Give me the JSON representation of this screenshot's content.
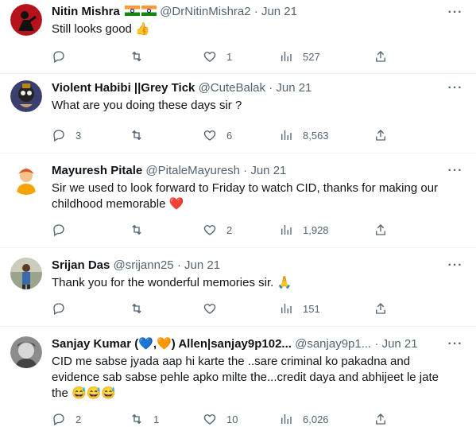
{
  "tweets": [
    {
      "name": "Nitin Mishra",
      "name_suffix_flags": 2,
      "handle": "@DrNitinMishra2",
      "sep": "·",
      "date": "Jun 21",
      "text": "Still looks good",
      "text_emoji": "👍",
      "replies": "",
      "retweets": "",
      "likes": "1",
      "views": "527",
      "avatar_color": "#c1121f"
    },
    {
      "name": "Violent Habibi ||Grey Tick",
      "handle": "@CuteBalak",
      "sep": "·",
      "date": "Jun 21",
      "text": "What are you doing these days  sir ?",
      "replies": "3",
      "retweets": "",
      "likes": "6",
      "views": "8,563",
      "avatar_color": "#2b2540"
    },
    {
      "name": "Mayuresh Pitale",
      "handle": "@PitaleMayuresh",
      "sep": "·",
      "date": "Jun 21",
      "text": "Sir we used to look forward to Friday to watch CID, thanks for making our childhood memorable",
      "text_emoji": "❤️",
      "replies": "",
      "retweets": "",
      "likes": "2",
      "views": "1,928",
      "avatar_color": "#f4a460"
    },
    {
      "name": "Srijan Das",
      "handle": "@srijann25",
      "sep": "·",
      "date": "Jun 21",
      "text": "Thank you for the wonderful memories sir.",
      "text_emoji": "🙏",
      "replies": "",
      "retweets": "",
      "likes": "",
      "views": "151",
      "avatar_color": "#8a8f7a"
    },
    {
      "name": "Sanjay Kumar (💙,🧡) Allen|sanjay9p102...",
      "handle": "@sanjay9p1...",
      "sep": "·",
      "date": "Jun 21",
      "text": "CID me sabse jyada aap hi karte the ..sare criminal ko pakadna and evidence sab sabse pehle apko milte the...credit daya and abhijeet le jate the",
      "text_emoji": "😅😅😅",
      "replies": "2",
      "retweets": "1",
      "likes": "10",
      "views": "6,026",
      "avatar_color": "#6b6b6b"
    }
  ],
  "icons": {
    "reply": "reply-icon",
    "retweet": "retweet-icon",
    "like": "heart-icon",
    "views": "views-icon",
    "share": "share-icon",
    "more": "more-icon"
  },
  "more_glyph": "···"
}
